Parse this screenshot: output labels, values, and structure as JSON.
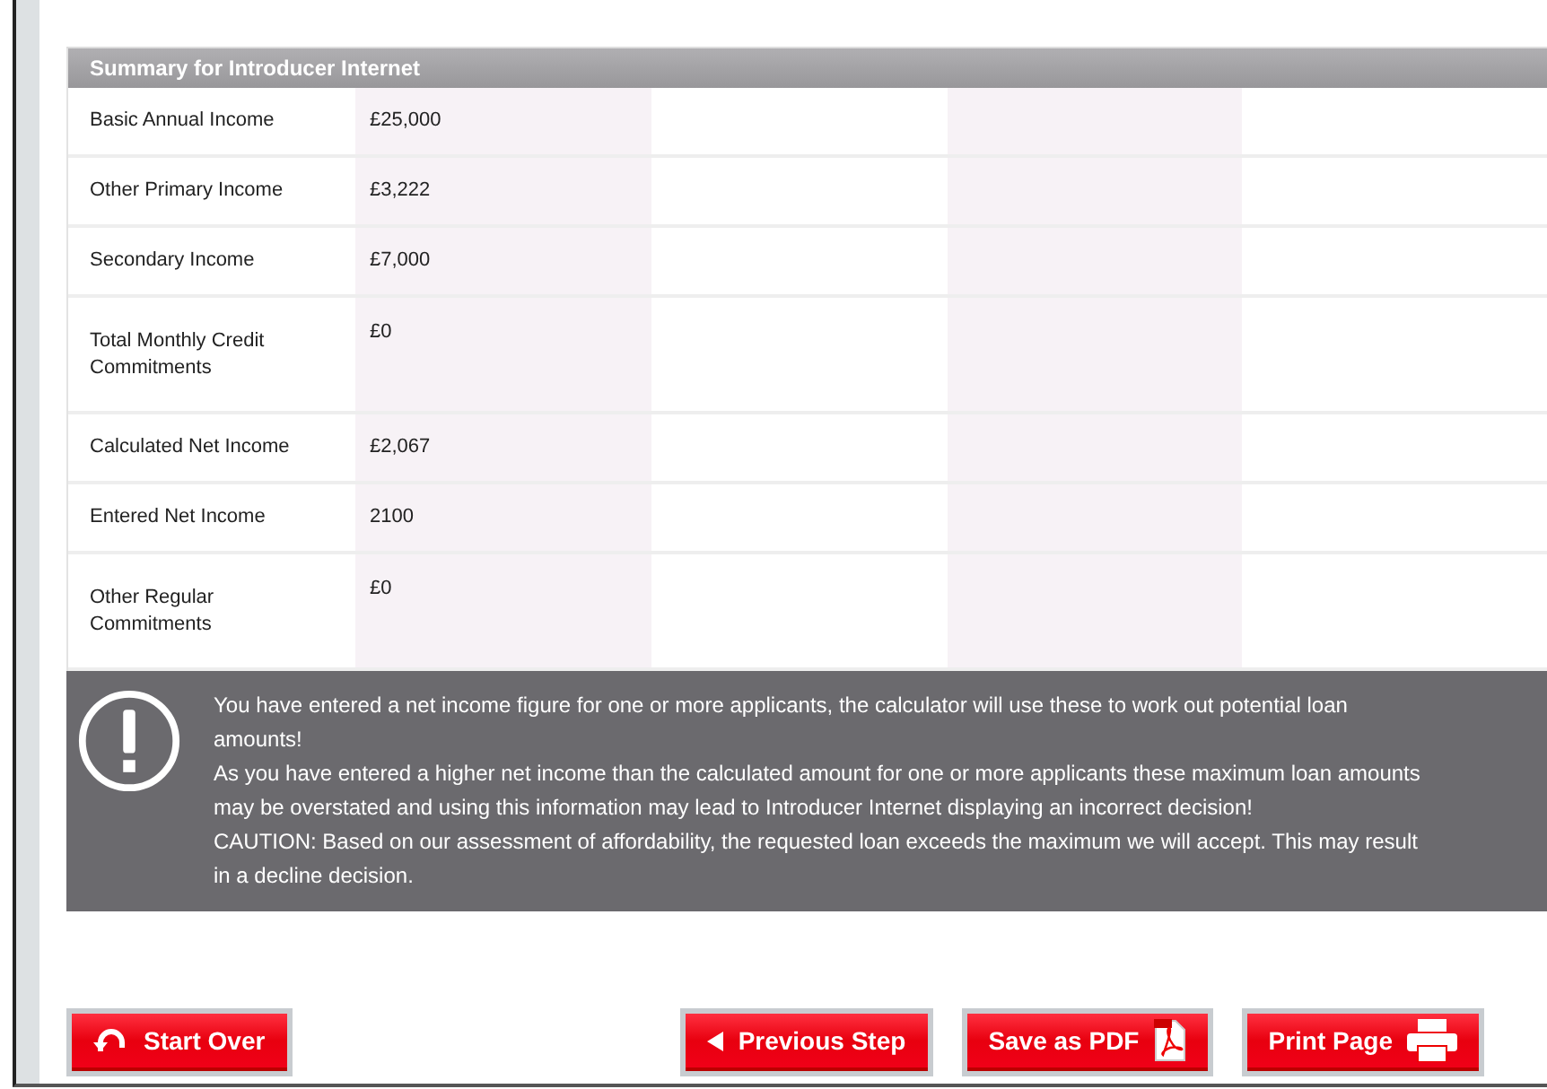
{
  "summary": {
    "title": "Summary for Introducer Internet",
    "rows": [
      {
        "label": "Basic Annual Income",
        "value": "£25,000"
      },
      {
        "label": "Other Primary Income",
        "value": "£3,222"
      },
      {
        "label": "Secondary Income",
        "value": "£7,000"
      },
      {
        "label": "Total Monthly Credit Commitments",
        "value": "£0"
      },
      {
        "label": "Calculated Net Income",
        "value": "£2,067"
      },
      {
        "label": "Entered Net Income",
        "value": "2100"
      },
      {
        "label": "Other Regular Commitments",
        "value": "£0"
      }
    ]
  },
  "warning": {
    "lines": [
      "You have entered a net income figure for one or more applicants, the calculator will use these to work out potential loan amounts!",
      "As you have entered a higher net income than the calculated amount for one or more applicants these maximum loan amounts may be overstated and using this information may lead to Introducer Internet displaying an incorrect decision!",
      "CAUTION: Based on our assessment of affordability, the requested loan exceeds the maximum we will accept. This may result in a decline decision."
    ]
  },
  "buttons": [
    {
      "label": "Start Over",
      "kind": "undo"
    },
    {
      "label": "Previous Step",
      "kind": "back"
    },
    {
      "label": "Save as PDF",
      "kind": "pdf"
    },
    {
      "label": "Print Page",
      "kind": "print"
    }
  ]
}
